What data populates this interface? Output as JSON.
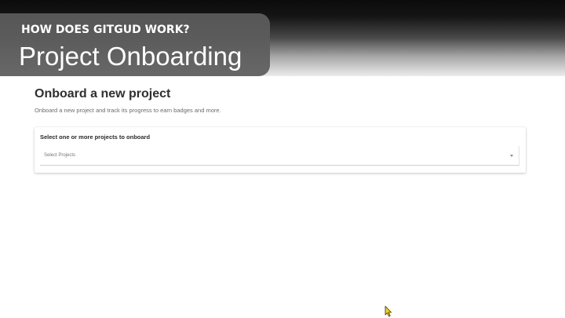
{
  "overlay": {
    "kicker": "HOW DOES GITGUD WORK?",
    "title": "Project Onboarding"
  },
  "page": {
    "heading": "Onboard a new project",
    "subtitle": "Onboard a new project and track its progress to earn badges and more."
  },
  "project_select": {
    "label": "Select one or more projects to onboard",
    "placeholder": "Select Projects",
    "caret_icon": "chevron-down-icon"
  },
  "cursor": {
    "icon": "mouse-pointer-icon",
    "color": "#f2d21b"
  },
  "colors": {
    "overlay_bg": "#5c5c5c",
    "heading": "#2f2f2f",
    "subtext": "#6b6b6b"
  }
}
